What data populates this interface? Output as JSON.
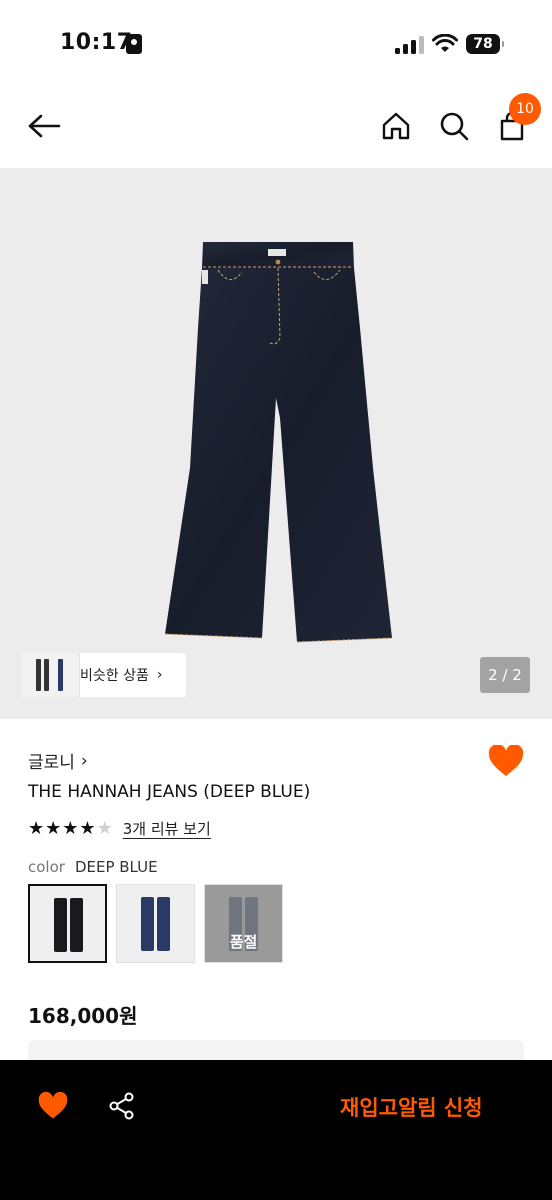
{
  "status_bar": {
    "time": "10:17",
    "battery": "78"
  },
  "nav": {
    "cart_count": "10"
  },
  "hero": {
    "similar_label": "비슷한 상품",
    "pager": "2 / 2"
  },
  "product": {
    "brand": "글로니",
    "title": "THE HANNAH JEANS (DEEP BLUE)",
    "rating": 4,
    "rating_max": 5,
    "review_link": "3개 리뷰 보기",
    "color_label": "color",
    "color_value": "DEEP BLUE",
    "soldout_label": "품절",
    "price": "168,000원"
  },
  "bottom_bar": {
    "restock_label": "재입고알림 신청"
  },
  "colors": {
    "accent": "#ff5a00",
    "denim_dark": "#1c2231",
    "denim_blue": "#2a3a66",
    "denim_gray": "#6f7680"
  },
  "icons": [
    "back-arrow-icon",
    "home-icon",
    "search-icon",
    "shopping-bag-icon",
    "chevron-right-icon",
    "heart-icon",
    "star-icon",
    "share-icon"
  ]
}
